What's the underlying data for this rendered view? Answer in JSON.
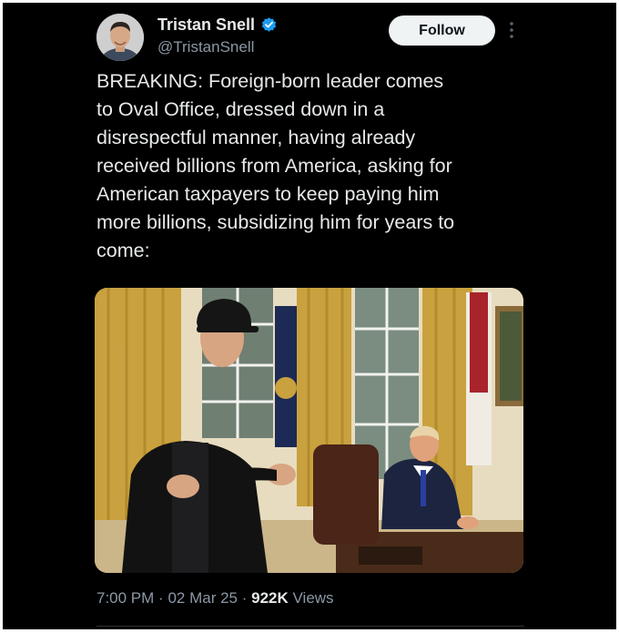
{
  "author": {
    "name": "Tristan Snell",
    "handle": "@TristanSnell",
    "verified": true,
    "avatar_icon": "profile-photo"
  },
  "actions": {
    "follow_label": "Follow",
    "more_icon": "more-vertical-icon"
  },
  "tweet": {
    "text": "BREAKING: Foreign-born leader comes\nto Oval Office, dressed down in a\ndisrespectful manner, having already\nreceived billions from America, asking for\nAmerican taxpayers to keep paying him\nmore billions, subsidizing him for years to\ncome:"
  },
  "meta": {
    "time": "7:00 PM",
    "separator": "·",
    "date": "02 Mar 25",
    "views_count": "922K",
    "views_label": "Views"
  },
  "colors": {
    "background": "#000000",
    "text": "#e7e9ea",
    "secondary": "#8b98a5",
    "verified": "#1d9bf0"
  }
}
